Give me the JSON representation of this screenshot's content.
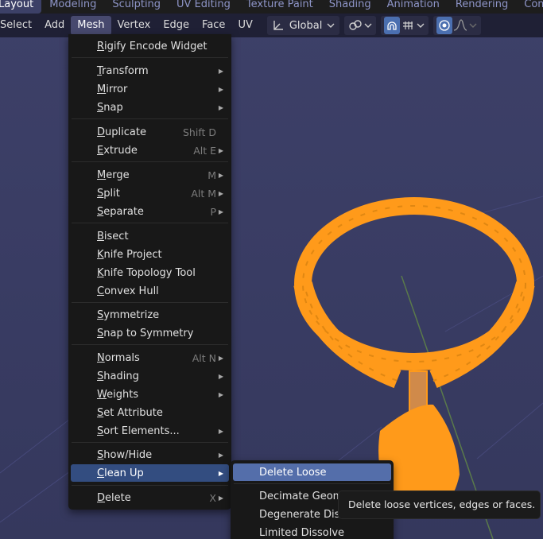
{
  "workspaces": [
    "Layout",
    "Modeling",
    "Sculpting",
    "UV Editing",
    "Texture Paint",
    "Shading",
    "Animation",
    "Rendering",
    "Compos"
  ],
  "header": {
    "menus": [
      "Select",
      "Add",
      "Mesh",
      "Vertex",
      "Edge",
      "Face",
      "UV"
    ],
    "transform_orientation": "Global",
    "icons": [
      "transform-axes-icon",
      "chevron-down-icon",
      "pivot-link-icon",
      "snap-magnet-icon",
      "snap-grid-icon",
      "proportional-edit-icon",
      "falloff-curve-icon"
    ]
  },
  "mesh_menu": {
    "items": [
      {
        "label": "Rigify Encode Widget",
        "shortcut": "",
        "submenu": false
      },
      {
        "label": "Transform",
        "shortcut": "",
        "submenu": true
      },
      {
        "label": "Mirror",
        "shortcut": "",
        "submenu": true
      },
      {
        "label": "Snap",
        "shortcut": "",
        "submenu": true
      },
      {
        "label": "Duplicate",
        "shortcut": "Shift D",
        "submenu": false
      },
      {
        "label": "Extrude",
        "shortcut": "Alt E",
        "submenu": true
      },
      {
        "label": "Merge",
        "shortcut": "M",
        "submenu": true
      },
      {
        "label": "Split",
        "shortcut": "Alt M",
        "submenu": true
      },
      {
        "label": "Separate",
        "shortcut": "P",
        "submenu": true
      },
      {
        "label": "Bisect",
        "shortcut": "",
        "submenu": false
      },
      {
        "label": "Knife Project",
        "shortcut": "",
        "submenu": false
      },
      {
        "label": "Knife Topology Tool",
        "shortcut": "",
        "submenu": false
      },
      {
        "label": "Convex Hull",
        "shortcut": "",
        "submenu": false
      },
      {
        "label": "Symmetrize",
        "shortcut": "",
        "submenu": false
      },
      {
        "label": "Snap to Symmetry",
        "shortcut": "",
        "submenu": false
      },
      {
        "label": "Normals",
        "shortcut": "Alt N",
        "submenu": true
      },
      {
        "label": "Shading",
        "shortcut": "",
        "submenu": true
      },
      {
        "label": "Weights",
        "shortcut": "",
        "submenu": true
      },
      {
        "label": "Set Attribute",
        "shortcut": "",
        "submenu": false
      },
      {
        "label": "Sort Elements...",
        "shortcut": "",
        "submenu": true
      },
      {
        "label": "Show/Hide",
        "shortcut": "",
        "submenu": true
      },
      {
        "label": "Clean Up",
        "shortcut": "",
        "submenu": true
      },
      {
        "label": "Delete",
        "shortcut": "X",
        "submenu": true
      }
    ]
  },
  "cleanup_submenu": {
    "items": [
      "Delete Loose",
      "Decimate Geometry",
      "Degenerate Dissolve",
      "Limited Dissolve"
    ]
  },
  "tooltip": "Delete loose vertices, edges or faces.",
  "colors": {
    "mesh_orange": "#ff9a1a",
    "menu_bg": "#181818",
    "highlight": "#334d80",
    "viewport_bg": "#393c63"
  }
}
